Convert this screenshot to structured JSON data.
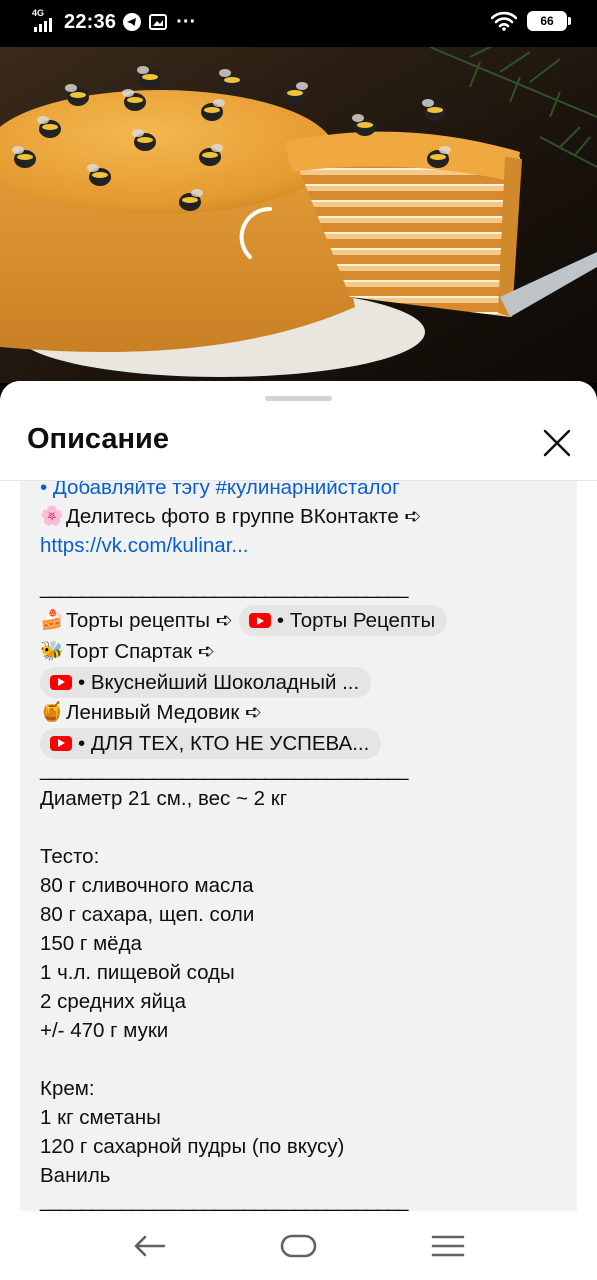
{
  "status_bar": {
    "network": "4G",
    "time": "22:36",
    "more": "···",
    "battery": "66"
  },
  "sheet": {
    "title": "Описание"
  },
  "description": {
    "cut_line": "• Добавляйте тэгу #кулинарнийсталог",
    "share_text": "Делитесь фото в группе ВКонтакте ➪",
    "vk_link": "https://vk.com/kulinar...",
    "separator": "____________________________________",
    "cakes_label": "Торты рецепты ➪",
    "cakes_chip": "• Торты Рецепты",
    "spartak_label": "Торт Спартак ➪",
    "spartak_chip": "• Вкуснейший Шоколадный ...",
    "lazy_label": "Ленивый Медовик ➪",
    "lazy_chip": "• ДЛЯ ТЕХ, КТО НЕ УСПЕВА...",
    "size": "Диаметр 21 см., вес ~ 2 кг",
    "dough_title": "Тесто:",
    "dough": [
      "80 г сливочного масла",
      "80 г сахара, щеп. соли",
      "150 г мёда",
      "1 ч.л. пищевой соды",
      "2 средних яйца",
      "+/- 470 г муки"
    ],
    "cream_title": "Крем:",
    "cream": [
      "1 кг сметаны",
      "120 г сахарной пудры (по вкусу)",
      "Ваниль"
    ]
  },
  "icons": {
    "flower": "🌸",
    "cake": "🍰",
    "bee": "🐝",
    "honey": "🍯"
  }
}
